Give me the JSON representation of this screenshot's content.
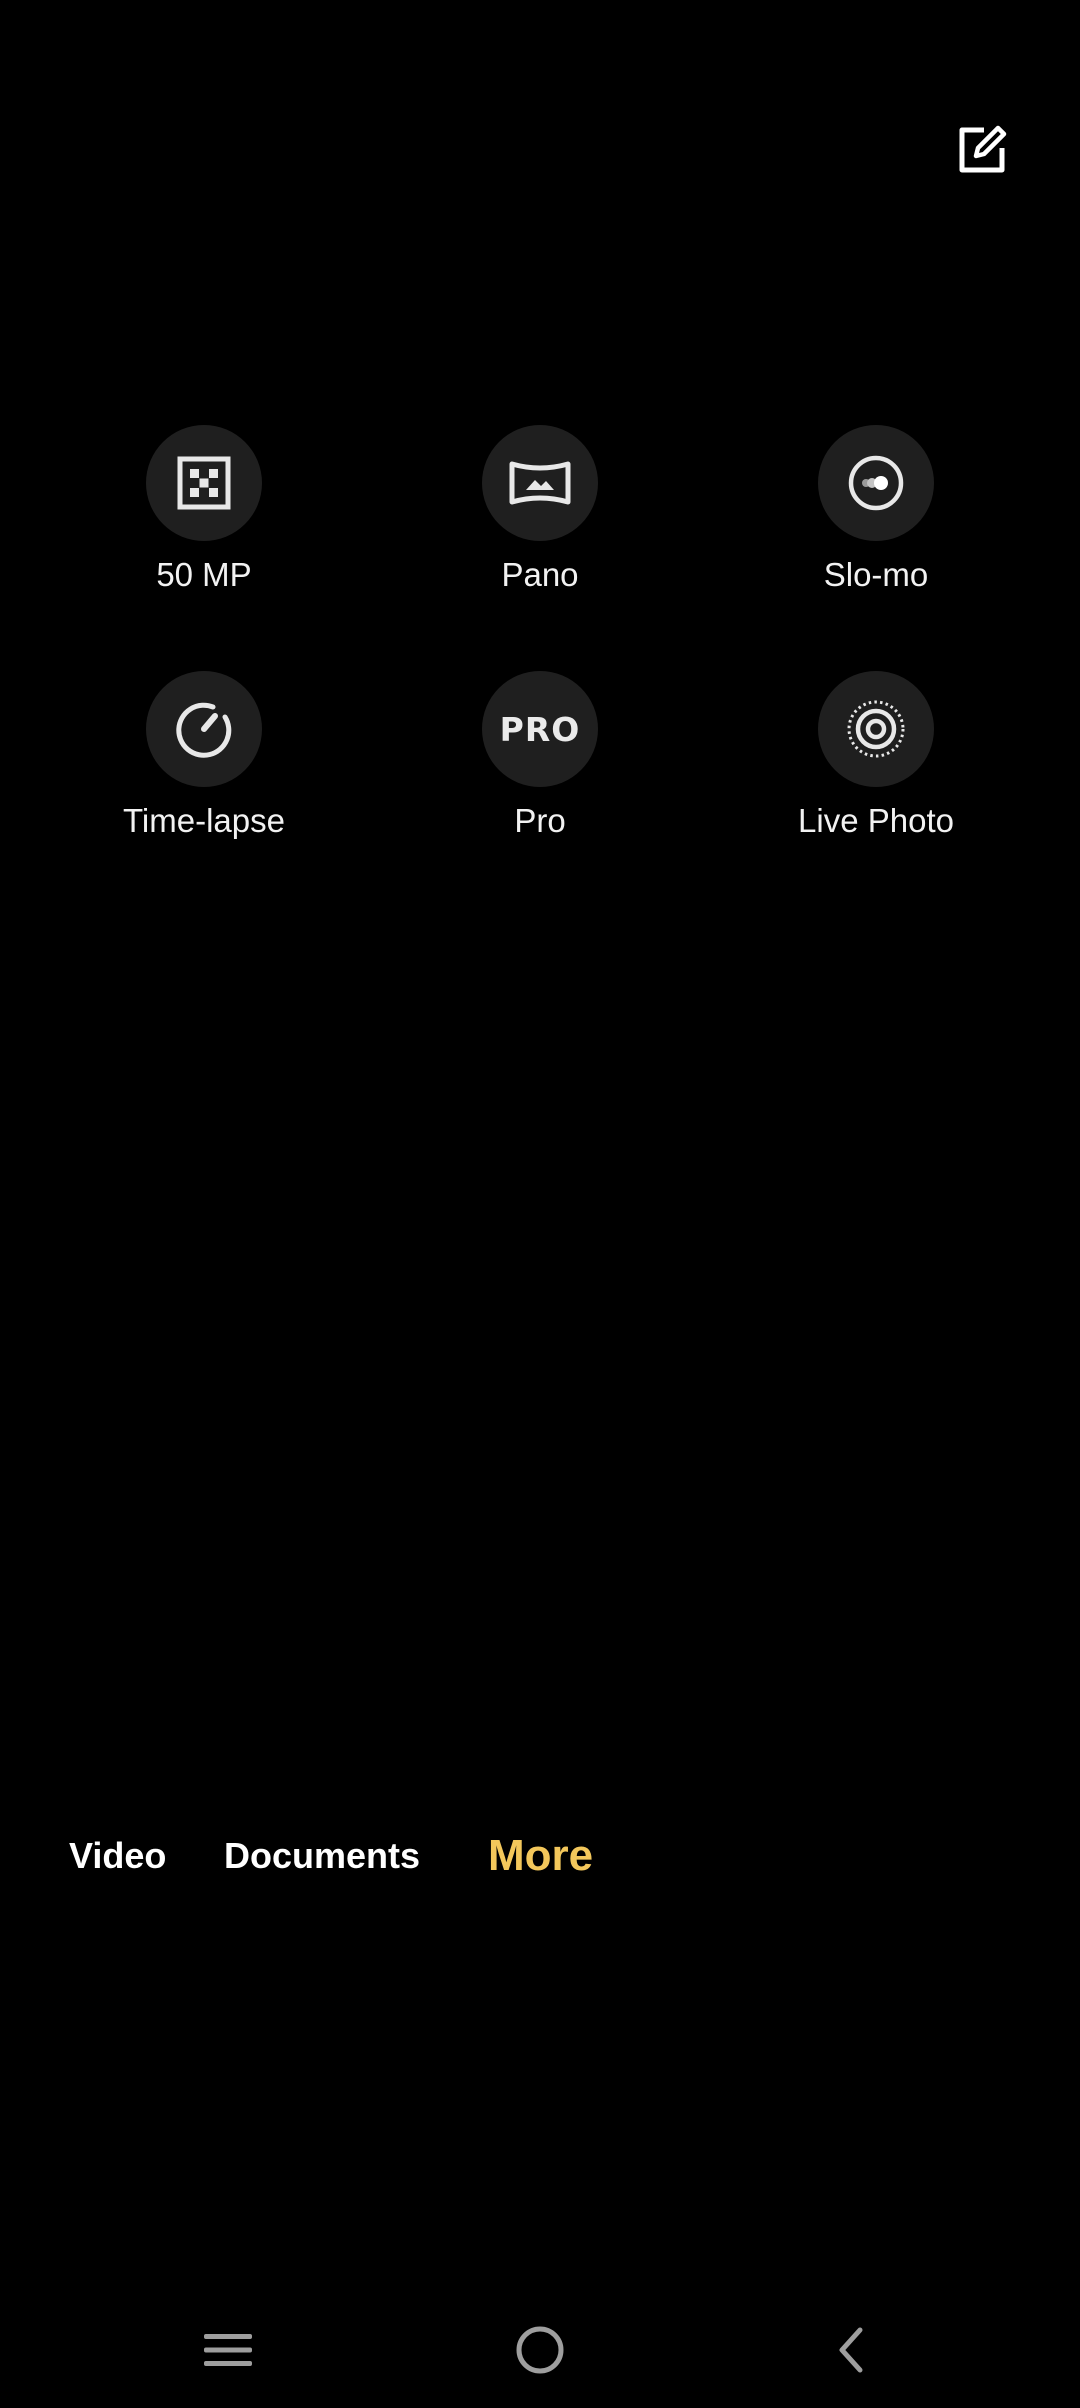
{
  "top_bar": {
    "edit_icon": "edit-square-icon"
  },
  "modes": [
    {
      "label": "50 MP",
      "icon": "50mp-grid-icon"
    },
    {
      "label": "Pano",
      "icon": "panorama-icon"
    },
    {
      "label": "Slo-mo",
      "icon": "slow-motion-icon"
    },
    {
      "label": "Time-lapse",
      "icon": "timelapse-dial-icon"
    },
    {
      "label": "Pro",
      "icon_text": "PRO"
    },
    {
      "label": "Live Photo",
      "icon": "live-photo-icon"
    }
  ],
  "tabs": [
    {
      "label": "Video",
      "active": false
    },
    {
      "label": "Documents",
      "active": false
    },
    {
      "label": "More",
      "active": true
    }
  ],
  "colors": {
    "background": "#000000",
    "accent": "#F3C75B",
    "mode_circle": "#1F1F1F"
  },
  "navbar": {
    "icons": [
      "menu-icon",
      "home-circle-icon",
      "back-chevron-icon"
    ]
  }
}
